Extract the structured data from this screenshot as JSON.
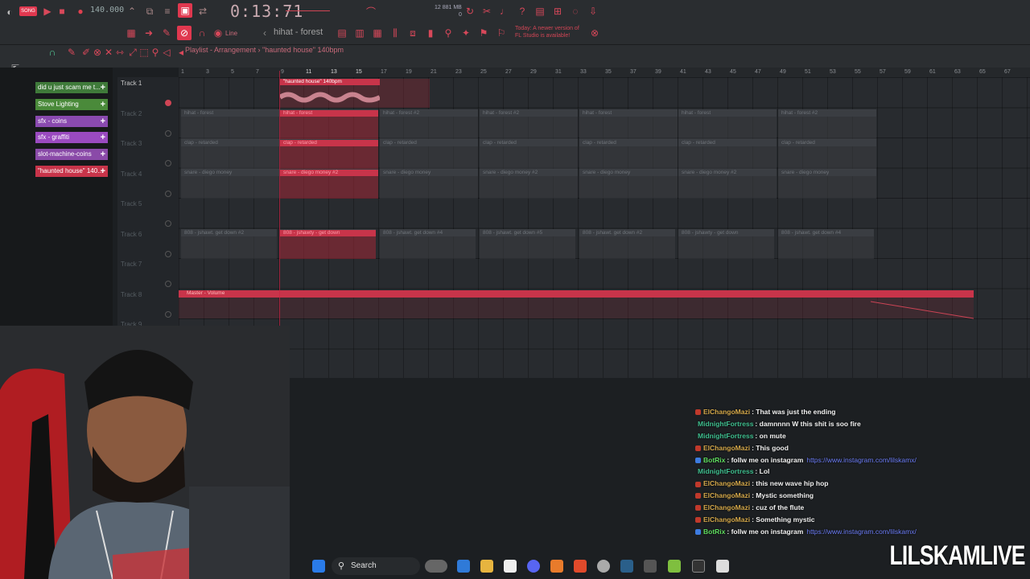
{
  "toolbar": {
    "song_mode": "SONG",
    "tempo": "140.000",
    "time": "0:13:71",
    "cpu_top": "12  881 MB",
    "cpu_bottom": "0",
    "pattern": "hihat - forest",
    "snap": "Line",
    "news_line1": "Today: A newer version of",
    "news_line2": "FL Studio is available!"
  },
  "playlist": {
    "title": "Playlist - Arrangement",
    "subtitle": "\"haunted house\" 140bpm",
    "ruler": [
      "1",
      "3",
      "5",
      "7",
      "9",
      "11",
      "13",
      "15",
      "17",
      "19",
      "21",
      "23",
      "25",
      "27",
      "29",
      "31",
      "33",
      "35",
      "37",
      "39",
      "41",
      "43",
      "45",
      "47",
      "49",
      "51",
      "53",
      "55",
      "57",
      "59",
      "61",
      "63",
      "65",
      "67"
    ],
    "tracks": [
      "Track 1",
      "Track 2",
      "Track 3",
      "Track 4",
      "Track 5",
      "Track 6",
      "Track 7",
      "Track 8",
      "Track 9"
    ],
    "audio_clip": "\"haunted house\" 140bpm",
    "automation_clip": "Master - Volume"
  },
  "browser": {
    "items": [
      {
        "label": "did u just scam me t...",
        "color": "#3f7a3a"
      },
      {
        "label": "Stove Lighting",
        "color": "#4a8a3a"
      },
      {
        "label": "sfx - coins",
        "color": "#8a4ab0"
      },
      {
        "label": "sfx - graffiti",
        "color": "#9a4ac0"
      },
      {
        "label": "slot-machine-coins",
        "color": "#8a4aa8"
      },
      {
        "label": "\"haunted house\" 140...",
        "color": "#c8344a"
      }
    ]
  },
  "clips": {
    "row2": [
      "hihat - forest",
      "hihat - forest",
      "hihat - forest #2",
      "hihat - forest #2",
      "hihat - forest",
      "hihat - forest",
      "hihat - forest #2"
    ],
    "row3": [
      "clap - retarded",
      "clap - retarded",
      "clap - retarded",
      "clap - retarded",
      "clap - retarded",
      "clap - retarded",
      "clap - retarded"
    ],
    "row4": [
      "snare - diego money",
      "snare - diego money #2",
      "snare - diego money",
      "snare - diego money #2",
      "snare - diego money",
      "snare - diego money #2",
      "snare - diego money"
    ],
    "row6": [
      "808 - jshawt. get down #2",
      "808 - jshawty - get down",
      "808 - jshawt. get down #4",
      "808 - jshawt. get down #5",
      "808 - jshawt. get down #2",
      "808 - jshawty - get down",
      "808 - jshawt. get down #4"
    ]
  },
  "chat": [
    {
      "user": "ElChangoMazi",
      "color": "#d4a84a",
      "badge": "#c0392b",
      "text": "That was just the ending"
    },
    {
      "user": "MidnightFortress",
      "color": "#3fbf8f",
      "badge": "",
      "text": "damnnnn W this shit is soo fire"
    },
    {
      "user": "MidnightFortress",
      "color": "#3fbf8f",
      "badge": "",
      "text": "on mute"
    },
    {
      "user": "ElChangoMazi",
      "color": "#d4a84a",
      "badge": "#c0392b",
      "text": "This good"
    },
    {
      "user": "BotRix",
      "color": "#5fdc5f",
      "badge": "#3d7be0",
      "text": "follw me on instagram",
      "link": "https://www.instagram.com/lilskamx/"
    },
    {
      "user": "MidnightFortress",
      "color": "#3fbf8f",
      "badge": "",
      "text": "Lol"
    },
    {
      "user": "ElChangoMazi",
      "color": "#d4a84a",
      "badge": "#c0392b",
      "text": "this new wave hip hop"
    },
    {
      "user": "ElChangoMazi",
      "color": "#d4a84a",
      "badge": "#c0392b",
      "text": "Mystic something"
    },
    {
      "user": "ElChangoMazi",
      "color": "#d4a84a",
      "badge": "#c0392b",
      "text": "cuz of the flute"
    },
    {
      "user": "ElChangoMazi",
      "color": "#d4a84a",
      "badge": "#c0392b",
      "text": "Something mystic"
    },
    {
      "user": "BotRix",
      "color": "#5fdc5f",
      "badge": "#3d7be0",
      "text": "follw me on instagram",
      "link": "https://www.instagram.com/lilskamx/"
    }
  ],
  "taskbar": {
    "search": "Search"
  },
  "overlay": {
    "brand": "LILSKAMLIVE"
  },
  "colors": {
    "accent": "#e0384f",
    "bg": "#1c1f22"
  }
}
